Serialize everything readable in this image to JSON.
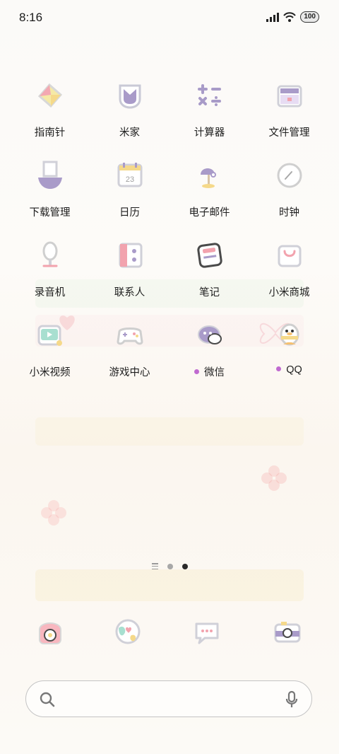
{
  "status_bar": {
    "time": "8:16",
    "battery": "100"
  },
  "apps": [
    {
      "label": "指南针",
      "icon": "compass-icon",
      "dot": false
    },
    {
      "label": "米家",
      "icon": "mijia-icon",
      "dot": false
    },
    {
      "label": "计算器",
      "icon": "calculator-icon",
      "dot": false
    },
    {
      "label": "文件管理",
      "icon": "file-manager-icon",
      "dot": false
    },
    {
      "label": "下载管理",
      "icon": "download-icon",
      "dot": false
    },
    {
      "label": "日历",
      "icon": "calendar-icon",
      "dot": false,
      "badge": "23"
    },
    {
      "label": "电子邮件",
      "icon": "email-icon",
      "dot": false
    },
    {
      "label": "时钟",
      "icon": "clock-icon",
      "dot": false
    },
    {
      "label": "录音机",
      "icon": "recorder-icon",
      "dot": false
    },
    {
      "label": "联系人",
      "icon": "contacts-icon",
      "dot": false
    },
    {
      "label": "笔记",
      "icon": "notes-icon",
      "dot": false
    },
    {
      "label": "小米商城",
      "icon": "mi-store-icon",
      "dot": false
    },
    {
      "label": "小米视频",
      "icon": "mi-video-icon",
      "dot": false
    },
    {
      "label": "游戏中心",
      "icon": "game-center-icon",
      "dot": false
    },
    {
      "label": "微信",
      "icon": "wechat-icon",
      "dot": true
    },
    {
      "label": "QQ",
      "icon": "qq-icon",
      "dot": true
    }
  ],
  "dock": [
    {
      "icon": "phone-icon"
    },
    {
      "icon": "browser-icon"
    },
    {
      "icon": "messages-icon"
    },
    {
      "icon": "camera-icon"
    }
  ],
  "colors": {
    "accent_dot": "#c06ad0",
    "icon_purple": "#9c8cc0",
    "icon_pink": "#f2a3ae"
  }
}
